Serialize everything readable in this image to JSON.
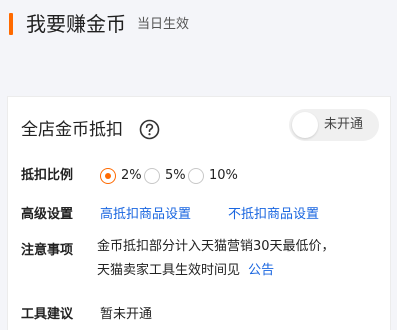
{
  "header": {
    "title": "我要赚金币",
    "subtitle": "当日生效"
  },
  "card": {
    "title": "全店金币抵扣",
    "help_icon": "question-circle-icon",
    "toggle": {
      "label": "未开通",
      "state": "off"
    },
    "ratio": {
      "label": "抵扣比例",
      "options": [
        "2%",
        "5%",
        "10%"
      ],
      "selected": "2%"
    },
    "advanced": {
      "label": "高级设置",
      "links": [
        "高抵扣商品设置",
        "不抵扣商品设置"
      ]
    },
    "notes": {
      "label": "注意事项",
      "line1": "金币抵扣部分计入天猫营销30天最低价，",
      "line2": "天猫卖家工具生效时间见",
      "link": "公告"
    },
    "suggestion": {
      "label": "工具建议",
      "value": "暂未开通"
    }
  },
  "colors": {
    "accent": "#ff6a00",
    "link": "#1a66e0",
    "background": "#f4f5f9"
  }
}
